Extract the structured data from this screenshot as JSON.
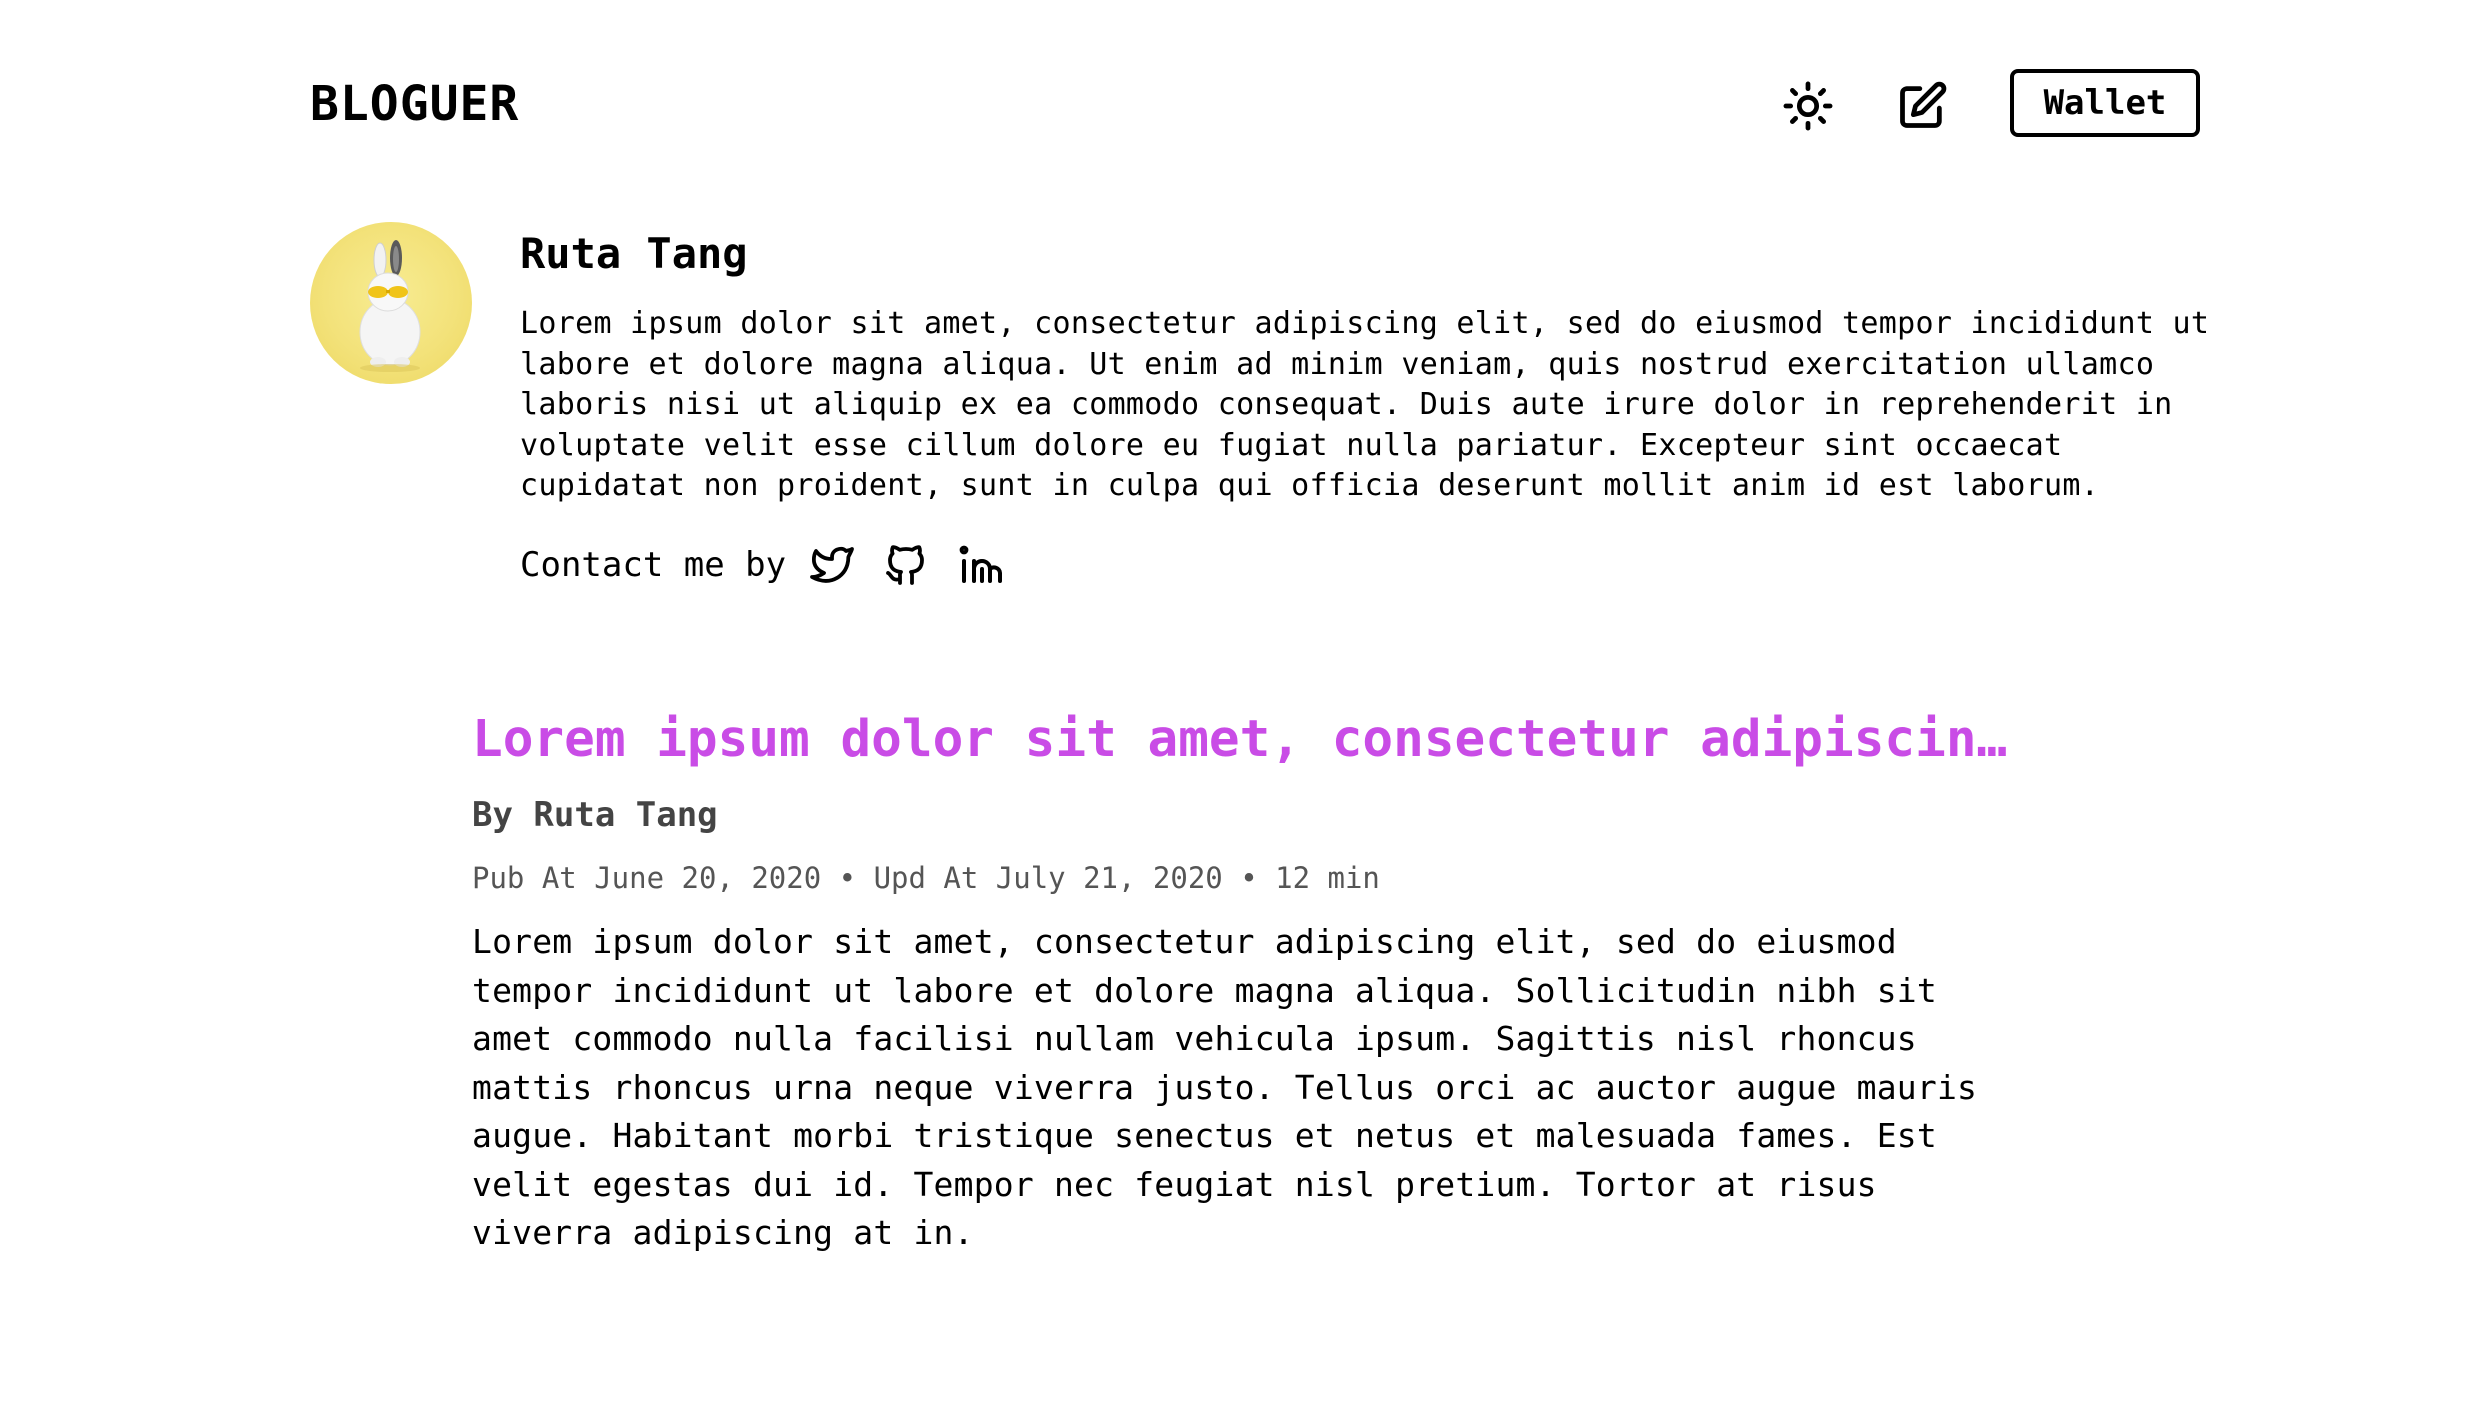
{
  "header": {
    "brand": "BLOGUER",
    "theme_icon": "sun-icon",
    "edit_icon": "edit-icon",
    "wallet_label": "Wallet"
  },
  "profile": {
    "avatar_icon": "avatar",
    "name": "Ruta Tang",
    "bio": "Lorem ipsum dolor sit amet, consectetur adipiscing elit, sed do eiusmod tempor incididunt ut labore et dolore magna aliqua. Ut enim ad minim veniam, quis nostrud exercitation ullamco laboris nisi ut aliquip ex ea commodo consequat. Duis aute irure dolor in reprehenderit in voluptate velit esse cillum dolore eu fugiat nulla pariatur. Excepteur sint occaecat cupidatat non proident, sunt in culpa qui officia deserunt mollit anim id est laborum.",
    "contact_label": "Contact me by",
    "social_icons": [
      "twitter-icon",
      "github-icon",
      "linkedin-icon"
    ]
  },
  "post": {
    "title": "Lorem ipsum dolor sit amet, consectetur adipiscing elit",
    "title_color": "#c94ce6",
    "author_line": "By Ruta Tang",
    "meta": "Pub At June 20, 2020 • Upd At July 21, 2020 • 12 min",
    "excerpt": "Lorem ipsum dolor sit amet, consectetur adipiscing elit, sed do eiusmod tempor incididunt ut labore et dolore magna aliqua. Sollicitudin nibh sit amet commodo nulla facilisi nullam vehicula ipsum. Sagittis nisl rhoncus mattis rhoncus urna neque viverra justo. Tellus orci ac auctor augue mauris augue. Habitant morbi tristique senectus et netus et malesuada fames. Est velit egestas dui id. Tempor nec feugiat nisl pretium. Tortor at risus viverra adipiscing at in."
  }
}
